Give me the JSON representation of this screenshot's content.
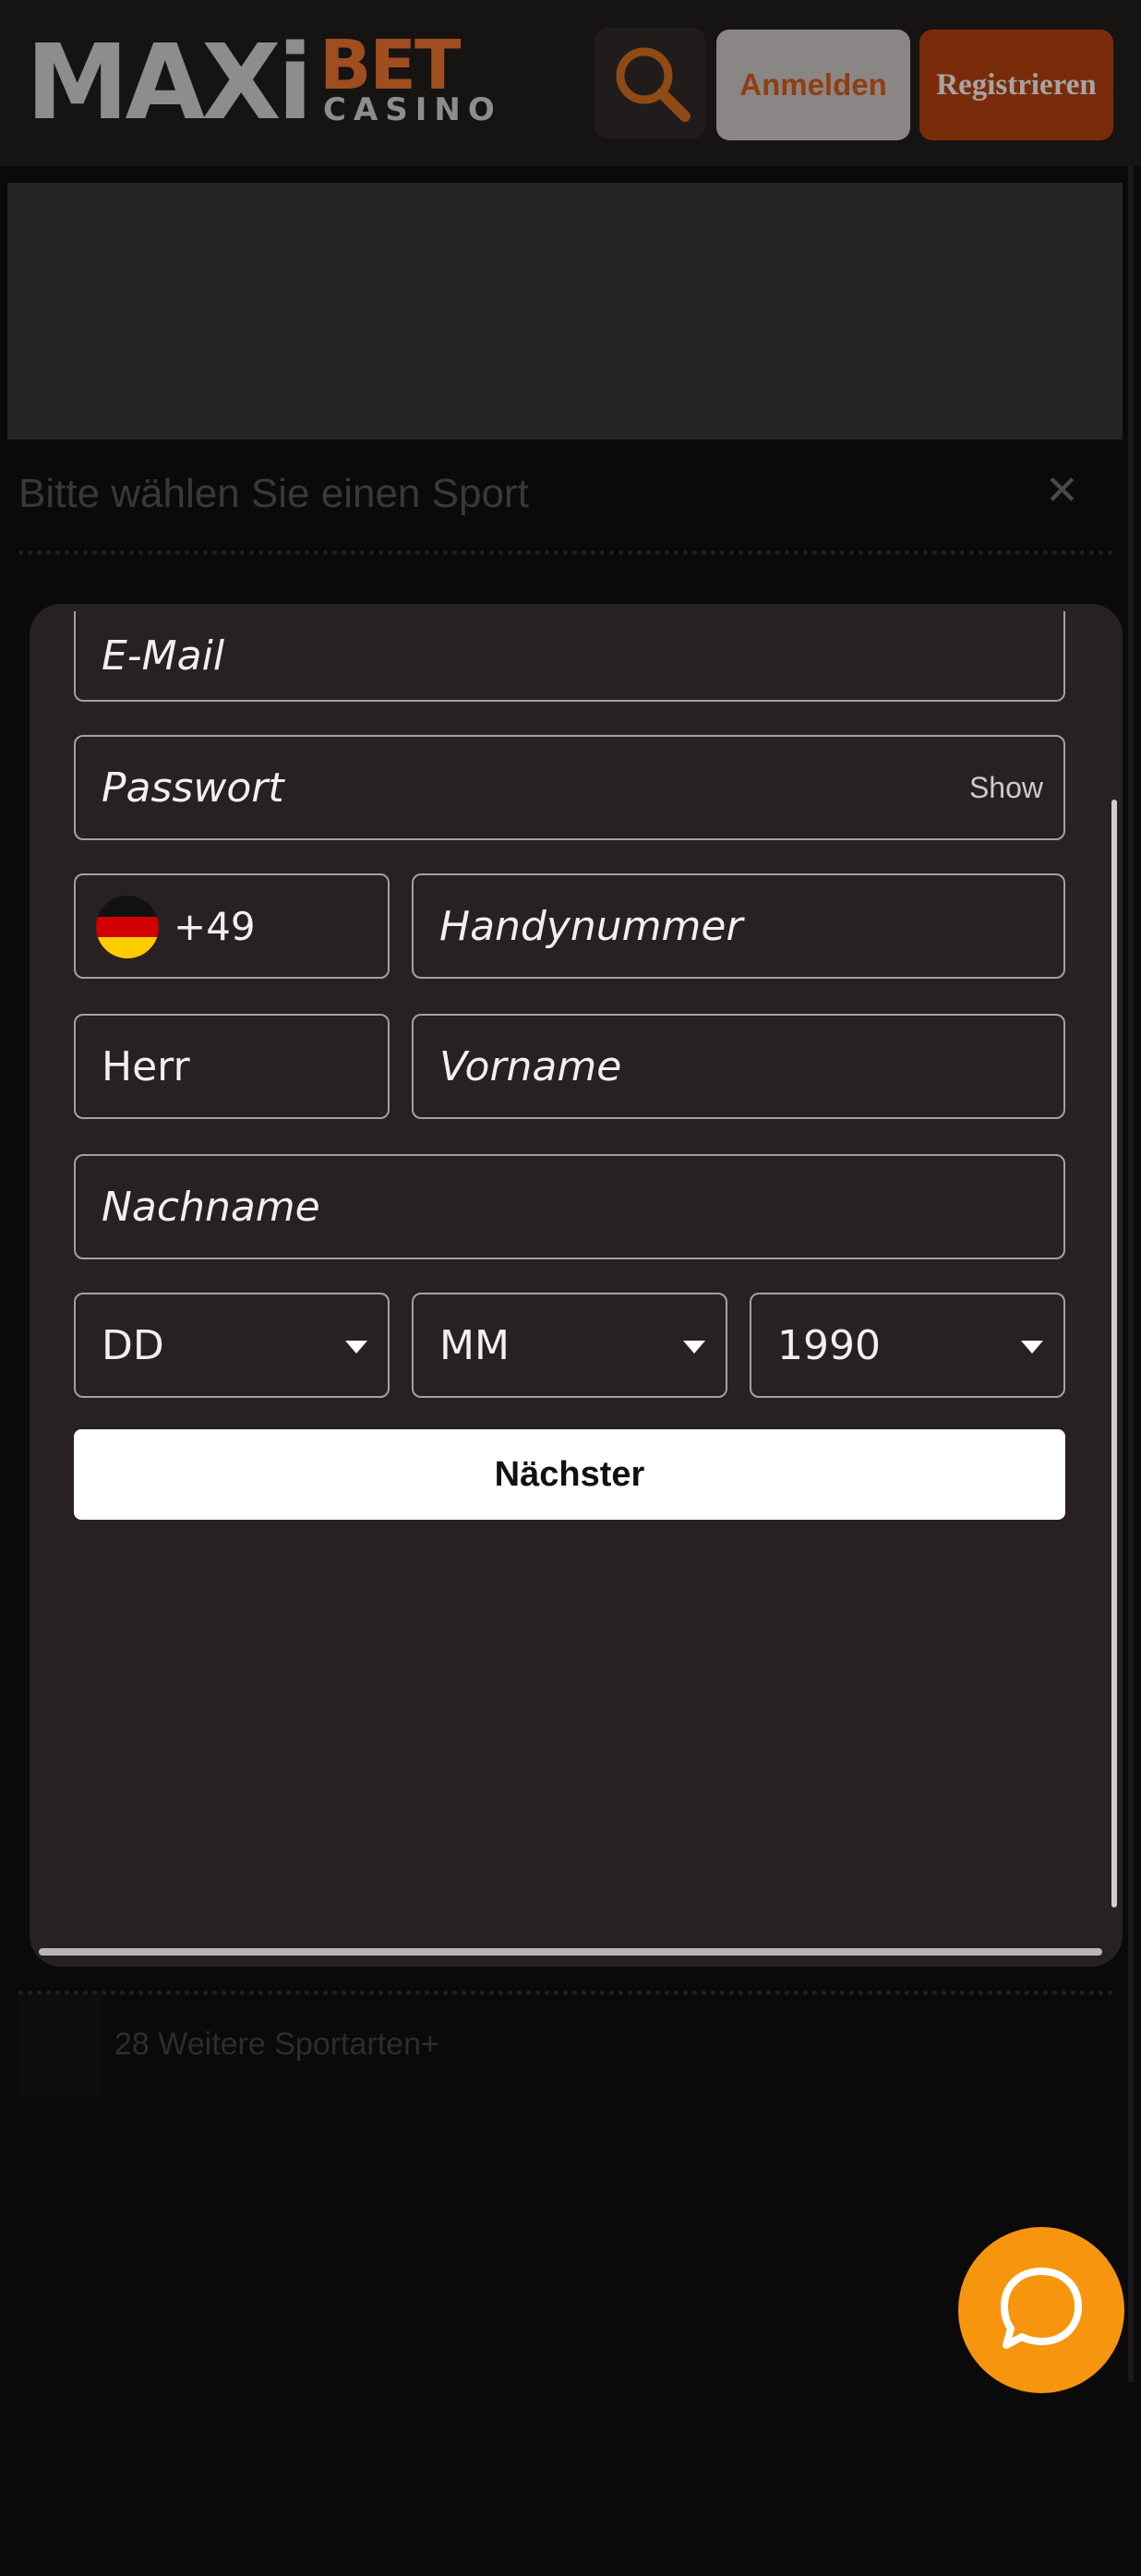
{
  "header": {
    "logo_maxi": "MAXi",
    "logo_bet": "BET",
    "logo_casino": "CASINO",
    "login_label": "Anmelden",
    "register_label": "Registrieren"
  },
  "background": {
    "sport_title": "Bitte wählen Sie einen Sport",
    "close_glyph": "✕",
    "more_sports": "28 Weitere Sportarten+"
  },
  "form": {
    "email_placeholder": "E-Mail",
    "password_placeholder": "Passwort",
    "show_label": "Show",
    "country_code": "+49",
    "phone_placeholder": "Handynummer",
    "salutation_value": "Herr",
    "firstname_placeholder": "Vorname",
    "lastname_placeholder": "Nachname",
    "day_value": "DD",
    "month_value": "MM",
    "year_value": "1990",
    "next_label": "Nächster"
  },
  "colors": {
    "brand_orange": "#f7950e",
    "modal_bg": "#272123"
  },
  "icons": {
    "search": "search-icon",
    "chat": "chat-icon",
    "flag": "germany-flag-icon",
    "caret": "caret-down-icon"
  }
}
